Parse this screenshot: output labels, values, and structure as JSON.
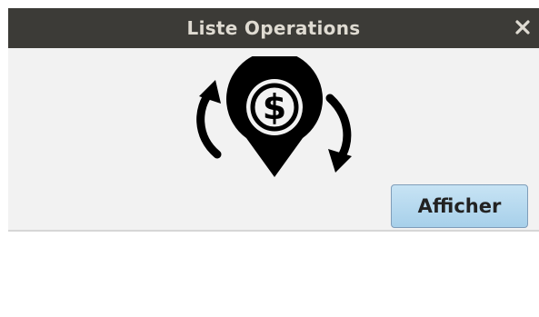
{
  "window": {
    "title": "Liste Operations"
  },
  "icons": {
    "close": "close-icon",
    "logo": "money-location-exchange-icon"
  },
  "content": {
    "dollar_sign": "$",
    "button_label": "Afficher"
  },
  "colors": {
    "titlebar": "#3c3b37",
    "title_text": "#dfdbd2",
    "dialog_bg": "#f2f2f2",
    "button_bg": "#b7d9ee"
  }
}
